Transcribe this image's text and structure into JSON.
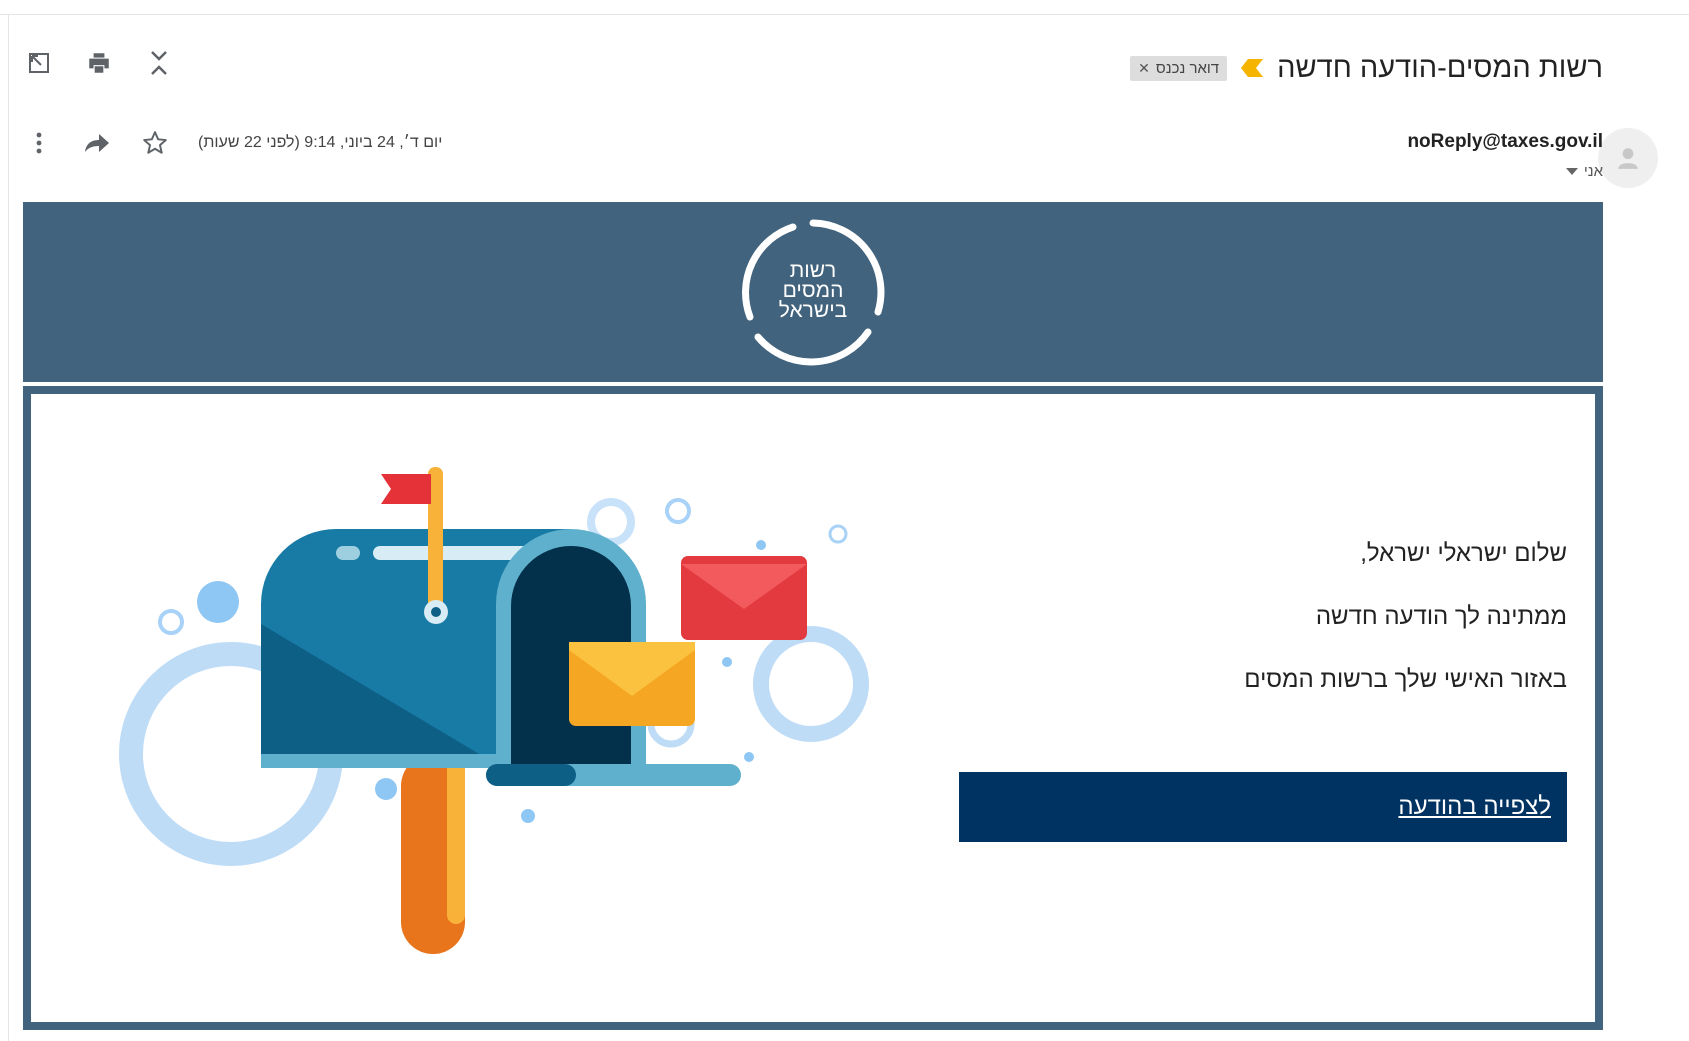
{
  "email": {
    "subject": "רשות המסים-הודעה חדשה",
    "label": "דואר נכנס",
    "sender": "noReply@taxes.gov.il",
    "to": "אני",
    "date": "יום ד׳, 24 ביוני, 9:14 (לפני 22 שעות)"
  },
  "logo": {
    "lines": [
      "רשות",
      "המסים",
      "בישראל"
    ]
  },
  "body": {
    "greeting": "שלום ישראלי ישראל,",
    "line1": "ממתינה לך הודעה חדשה",
    "line2": "באזור האישי שלך ברשות המסים",
    "button": "לצפייה בהודעה"
  },
  "colors": {
    "banner": "#41637d",
    "button": "#003262",
    "importance": "#f4b400"
  },
  "icons": [
    "open-in-new-window-icon",
    "print-icon",
    "collapse-icon",
    "star-icon",
    "reply-icon",
    "more-vert-icon",
    "person-icon",
    "dropdown-icon",
    "importance-icon"
  ]
}
